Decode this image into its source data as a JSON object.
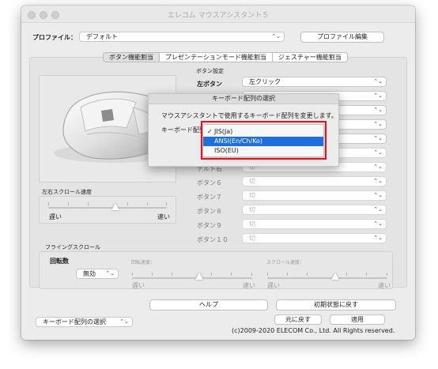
{
  "window": {
    "title": "エレコム マウスアシスタント５"
  },
  "profile": {
    "label": "プロファイル：",
    "value": "デフォルト",
    "edit_button": "プロファイル編集"
  },
  "tabs": [
    "ボタン機能割当",
    "プレゼンテーションモード機能割当",
    "ジェスチャー機能割当"
  ],
  "button_settings": {
    "section_label": "ボタン設定",
    "rows": [
      {
        "label": "左ボタン",
        "value": "左クリック",
        "enabled": true
      },
      {
        "label": "",
        "value": "",
        "enabled": true
      },
      {
        "label": "",
        "value": "",
        "enabled": true
      },
      {
        "label": "",
        "value": "",
        "enabled": true
      },
      {
        "label": "",
        "value": "",
        "enabled": true
      },
      {
        "label": "",
        "value": "",
        "enabled": false
      },
      {
        "label": "",
        "value": "",
        "enabled": false
      },
      {
        "label": "チルト右",
        "value": "切",
        "enabled": false
      },
      {
        "label": "ボタン６",
        "value": "切",
        "enabled": false
      },
      {
        "label": "ボタン７",
        "value": "切",
        "enabled": false
      },
      {
        "label": "ボタン８",
        "value": "切",
        "enabled": false
      },
      {
        "label": "ボタン９",
        "value": "切",
        "enabled": false
      },
      {
        "label": "ボタン１０",
        "value": "切",
        "enabled": false
      }
    ]
  },
  "tilt_scroll": {
    "label": "左右スクロール速度",
    "slow": "遅い",
    "fast": "速い",
    "level": 0.5
  },
  "flying_scroll": {
    "label": "フライングスクロール",
    "rotation_count_label": "回転数",
    "rotation_count_value": "無効",
    "rotation_speed": {
      "label": "回転速度：",
      "slow": "遅い",
      "fast": "速い",
      "level": 0.5
    },
    "scroll_speed": {
      "label": "スクロール速度：",
      "slow": "遅い",
      "fast": "速い",
      "level": 0.5
    }
  },
  "buttons": {
    "help": "ヘルプ",
    "reset": "初期状態に戻す",
    "revert": "元に戻す",
    "apply": "適用"
  },
  "bottom_select": "キーボード配列の選択",
  "copyright": "(c)2009-2020 ELECOM Co., Ltd. All Rights reserved.",
  "dialog": {
    "title": "キーボード配列の選択",
    "message": "マウスアシスタントで使用するキーボード配列を変更します。",
    "field_label": "キーボード配列",
    "options": [
      "JIS(Ja)",
      "ANSI(En/Ch/Ko)",
      "ISO(EU)"
    ],
    "checked_option": "JIS(Ja)",
    "highlighted_option": "ANSI(En/Ch/Ko)"
  },
  "colors": {
    "highlight": "#1d6fe0",
    "annotation": "#e0141e"
  },
  "icons": {
    "chevron": "updown-chevron-icon",
    "check": "checkmark-icon"
  }
}
